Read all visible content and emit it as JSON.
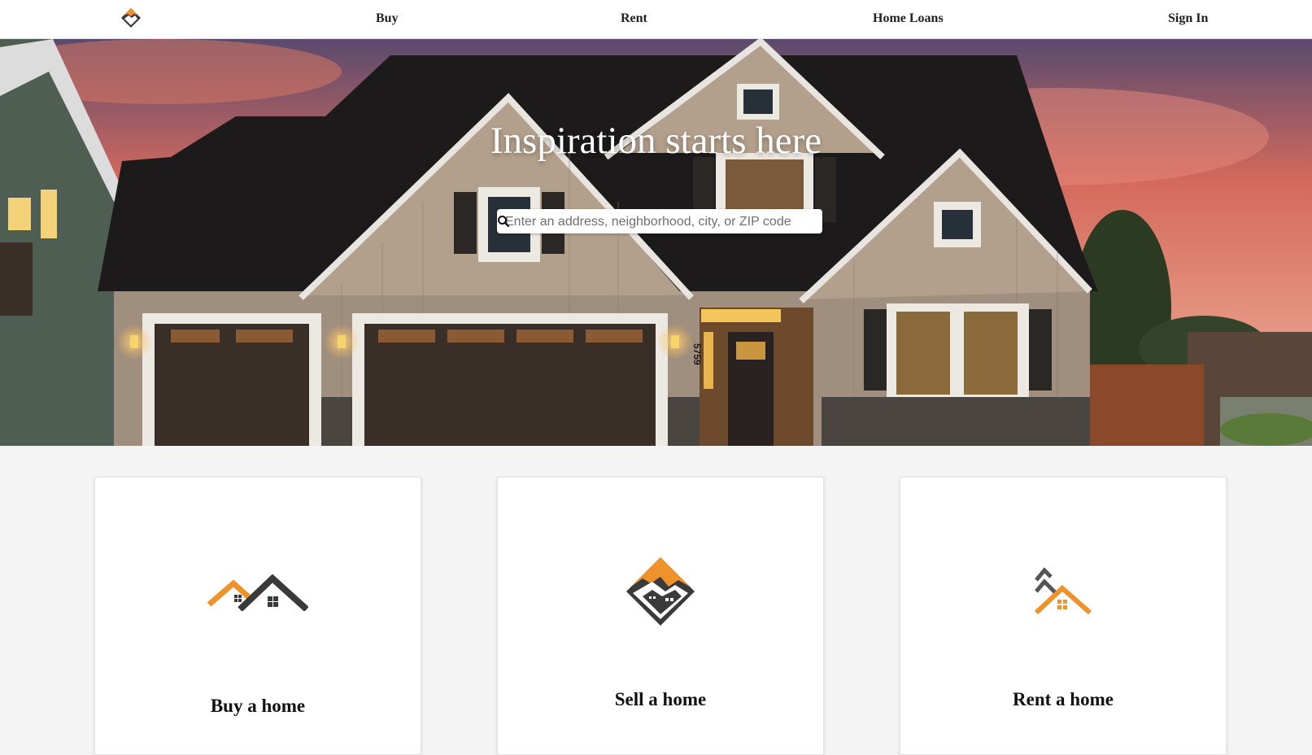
{
  "nav": {
    "logo_icon": "house-diamond-logo-icon",
    "links": [
      "Buy",
      "Rent",
      "Home Loans",
      "Sign In"
    ]
  },
  "hero": {
    "title": "Inspiration starts here",
    "search": {
      "placeholder": "Enter an address, neighborhood, city, or ZIP code",
      "value": "",
      "icon": "search-icon"
    },
    "house_number": "5759"
  },
  "cards": [
    {
      "label": "Buy a home",
      "icon": "two-roofs-icon"
    },
    {
      "label": "Sell a home",
      "icon": "house-diamond-icon"
    },
    {
      "label": "Rent a home",
      "icon": "roof-stack-icon"
    }
  ],
  "colors": {
    "accent": "#f0922b",
    "dark_icon": "#3a3a3a",
    "nav_bg": "#ffffff",
    "page_bg": "#f4f4f4"
  }
}
